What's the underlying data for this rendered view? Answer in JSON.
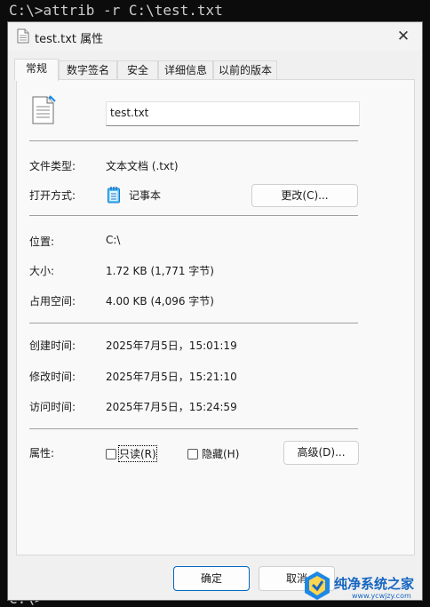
{
  "console": {
    "command": "C:\\>attrib -r C:\\test.txt",
    "prompt_bottom": "C:\\>"
  },
  "dialog": {
    "title": "test.txt 属性",
    "close_glyph": "✕",
    "tabs": [
      "常规",
      "数字签名",
      "安全",
      "详细信息",
      "以前的版本"
    ],
    "filename": "test.txt",
    "rows": {
      "file_type_label": "文件类型:",
      "file_type_value": "文本文档 (.txt)",
      "open_with_label": "打开方式:",
      "open_with_value": "记事本",
      "change_button": "更改(C)...",
      "location_label": "位置:",
      "location_value": "C:\\",
      "size_label": "大小:",
      "size_value": "1.72 KB (1,771 字节)",
      "disk_size_label": "占用空间:",
      "disk_size_value": "4.00 KB (4,096 字节)",
      "created_label": "创建时间:",
      "created_value": "2025年7月5日，15:01:19",
      "modified_label": "修改时间:",
      "modified_value": "2025年7月5日，15:21:10",
      "accessed_label": "访问时间:",
      "accessed_value": "2025年7月5日，15:24:59",
      "attributes_label": "属性:",
      "readonly_label": "只读(R)",
      "readonly_checked": false,
      "hidden_label": "隐藏(H)",
      "hidden_checked": false,
      "advanced_button": "高级(D)..."
    },
    "footer": {
      "ok": "确定",
      "cancel": "取消"
    }
  },
  "watermark": {
    "text": "纯净系统之家",
    "url": "www.ycwjzy.com"
  },
  "colors": {
    "console_bg": "#0c0c0c",
    "dialog_bg": "#f0f0f0",
    "accent": "#0067c0"
  }
}
